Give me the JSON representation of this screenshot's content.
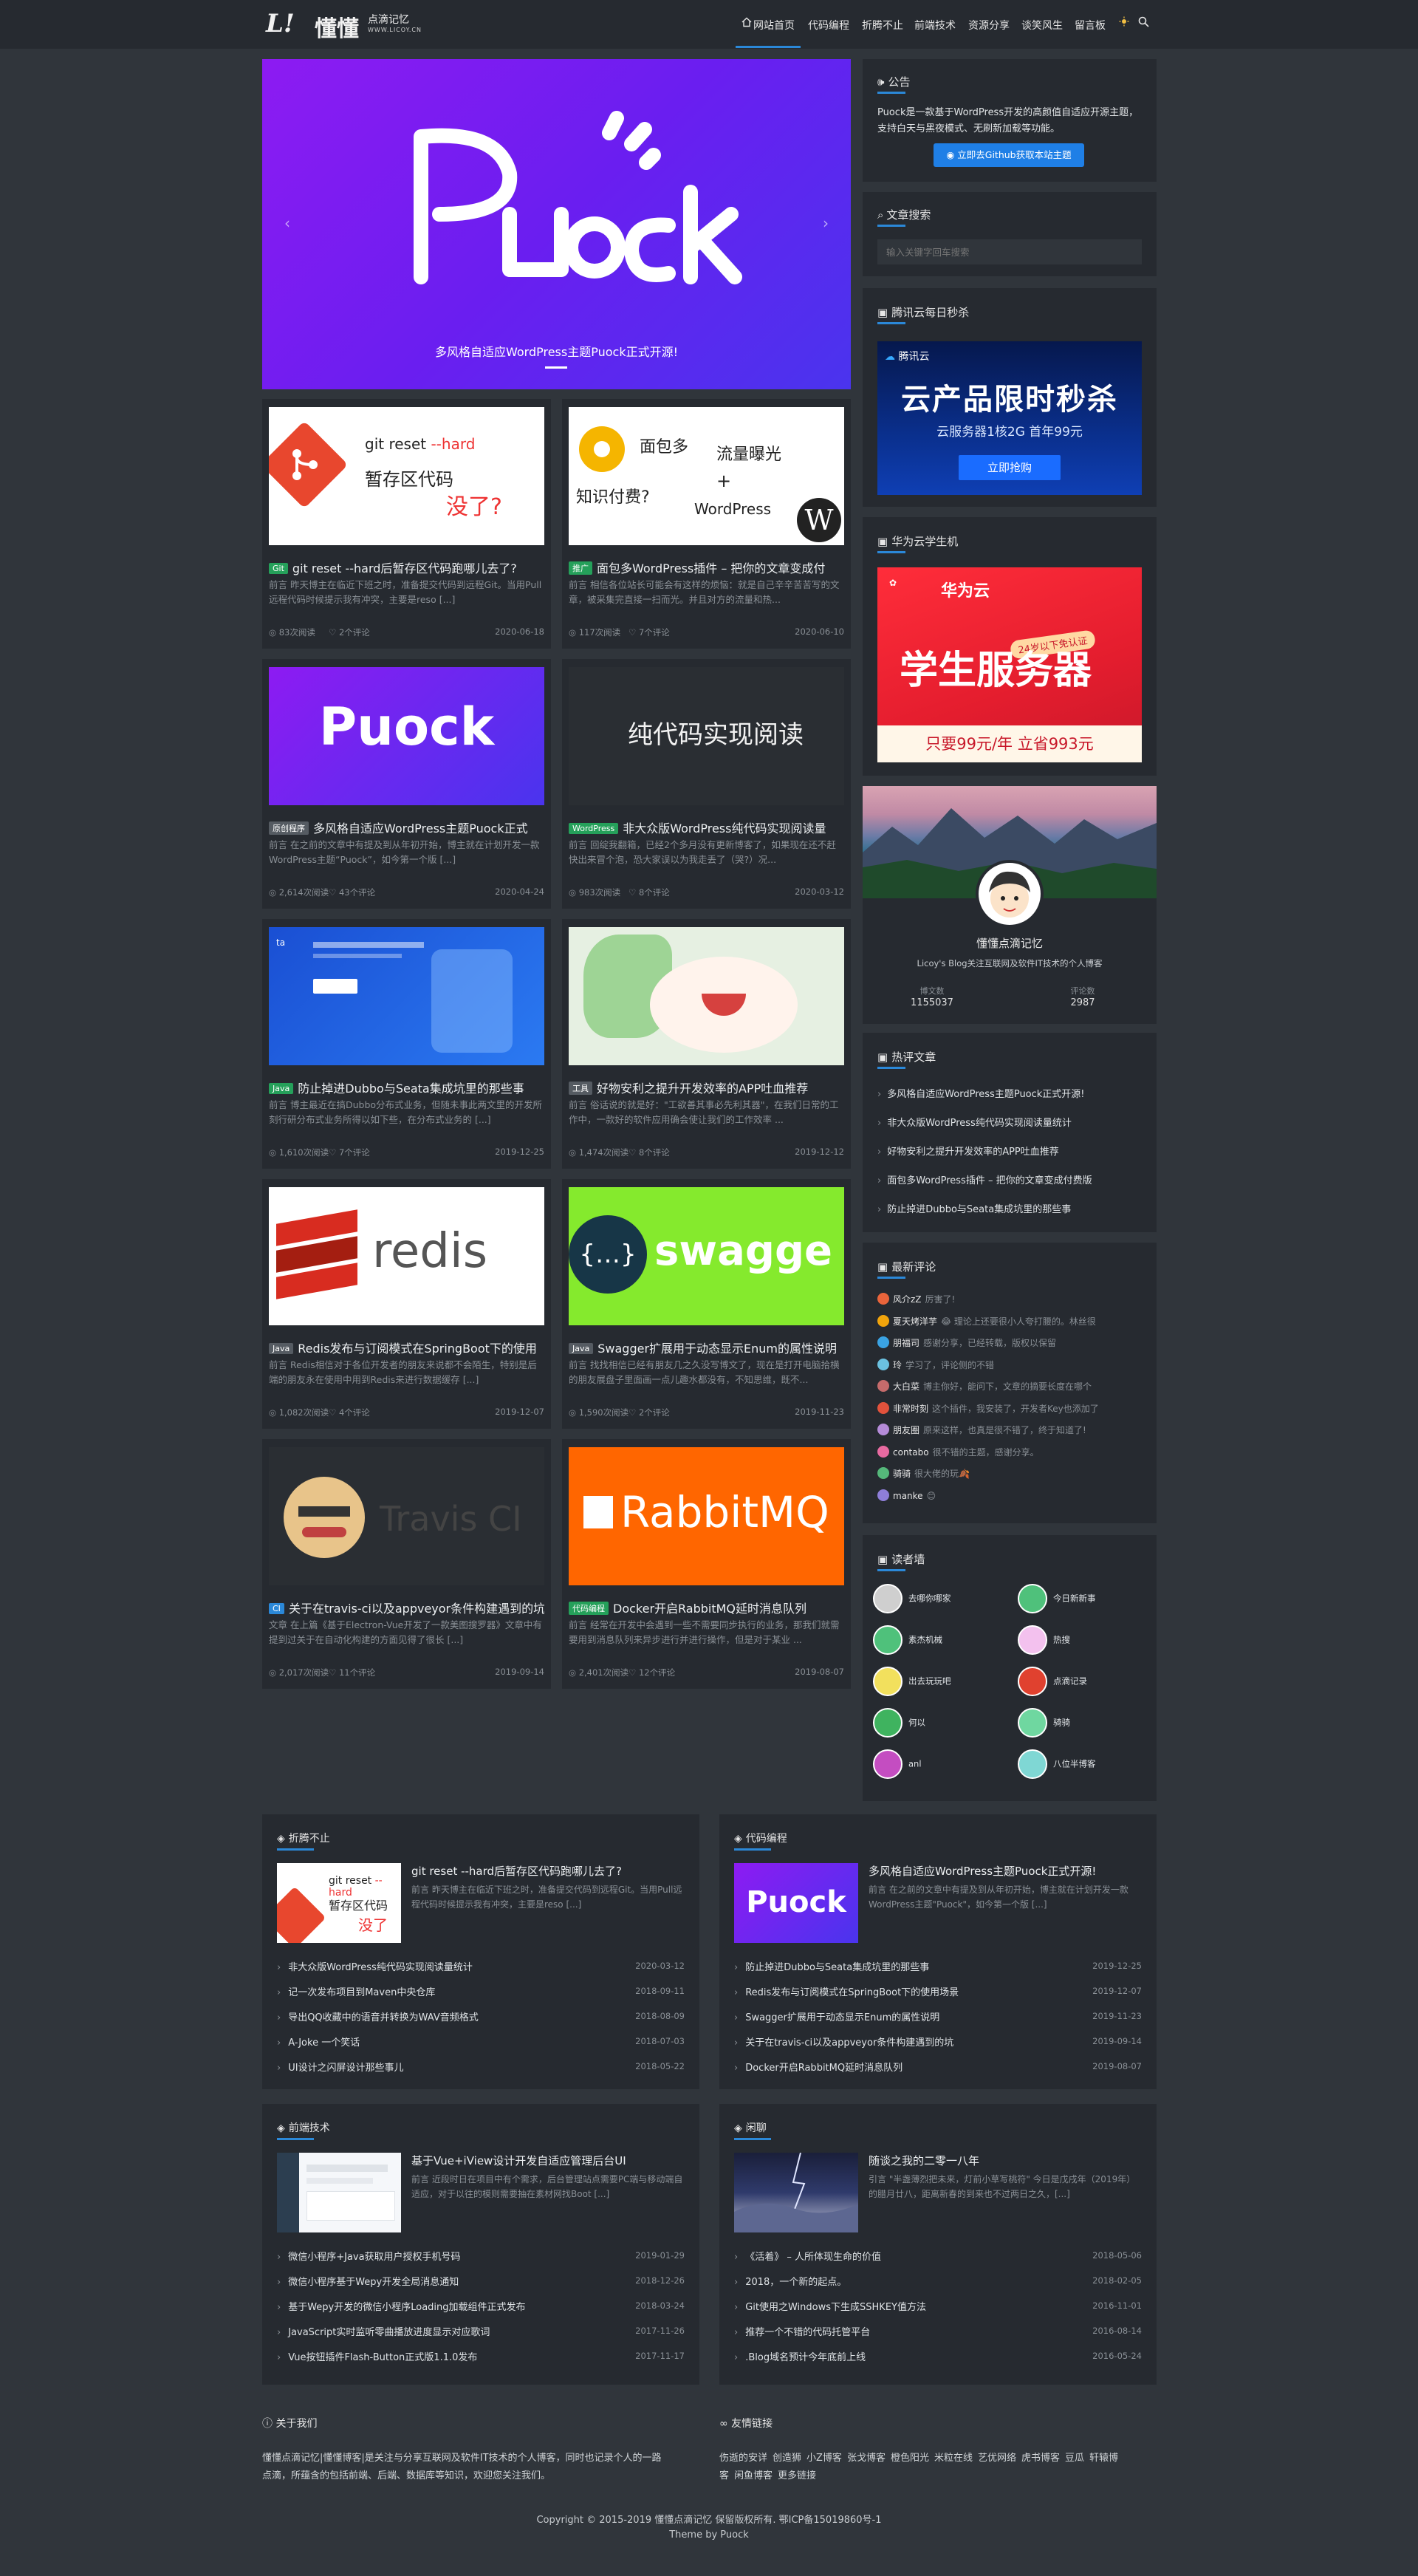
{
  "nav": {
    "logo_letters": "L!",
    "logo_title": "懂懂",
    "logo_script": "点滴记忆",
    "logo_url": "WWW.LICOY.CN",
    "items": [
      "网站首页",
      "代码编程",
      "折腾不止",
      "前端技术",
      "资源分享",
      "谈笑风生",
      "留言板"
    ],
    "theme_icon": "sun-icon",
    "search_icon": "search-icon"
  },
  "colors": {
    "accent": "#2b88d8",
    "bg": "#30353b",
    "card": "#262a30"
  },
  "slider": {
    "caption": "多风格自适应WordPress主题Puock正式开源!",
    "logo_text": "Puock"
  },
  "posts": [
    {
      "tag": "Git",
      "tag_color": "#25a05a",
      "title": "git reset --hard后暂存区代码跑哪儿去了?",
      "excerpt": "前言 昨天博主在临近下班之时，准备提交代码到远程Git。当用Pull远程代码时候提示我有冲突，主要是reso [...]",
      "views": "83次阅读",
      "comments": "2个评论",
      "date": "2020-06-18"
    },
    {
      "tag": "推广",
      "tag_color": "#25a05a",
      "title": "面包多WordPress插件 – 把你的文章变成付",
      "excerpt": "前言 相信各位站长可能会有这样的烦恼：就是自己辛辛苦苦写的文章，被采集完直接一扫而光。并且对方的流量和热...",
      "views": "117次阅读",
      "comments": "7个评论",
      "date": "2020-06-10"
    },
    {
      "tag": "原创程序",
      "tag_color": "#555b62",
      "title": "多风格自适应WordPress主题Puock正式",
      "excerpt": "前言 在之前的文章中有提及到从年初开始，博主就在计划开发一款WordPress主题“Puock”，如今第一个版 [...]",
      "views": "2,614次阅读",
      "comments": "43个评论",
      "date": "2020-04-24"
    },
    {
      "tag": "WordPress",
      "tag_color": "#25a05a",
      "title": "非大众版WordPress纯代码实现阅读量",
      "excerpt": "前言 回绽我翻箱，已经2个多月没有更新博客了，如果现在还不赶快出来冒个泡，恐大家误以为我走丢了（哭?）况...",
      "views": "983次阅读",
      "comments": "8个评论",
      "date": "2020-03-12"
    },
    {
      "tag": "Java",
      "tag_color": "#25a05a",
      "title": "防止掉进Dubbo与Seata集成坑里的那些事",
      "excerpt": "前言 博主最近在搞Dubbo分布式业务，但随未事此两文里的开发所刻行研分布式业务所得以如下些，在分布式业务的 [...]",
      "views": "1,610次阅读",
      "comments": "7个评论",
      "date": "2019-12-25"
    },
    {
      "tag": "工具",
      "tag_color": "#555b62",
      "title": "好物安利之提升开发效率的APP吐血推荐",
      "excerpt": "前言 俗话说的就是好：\"工欲善其事必先利其器\"，在我们日常的工作中，一款好的软件应用确会使让我们的工作效率 ...",
      "views": "1,474次阅读",
      "comments": "8个评论",
      "date": "2019-12-12"
    },
    {
      "tag": "Java",
      "tag_color": "#555b62",
      "title": "Redis发布与订阅模式在SpringBoot下的使用",
      "excerpt": "前言 Redis相信对于各位开发者的朋友来说都不会陌生，特别是后端的朋友永在使用中用到Redis来进行数据缓存 [...]",
      "views": "1,082次阅读",
      "comments": "4个评论",
      "date": "2019-12-07"
    },
    {
      "tag": "Java",
      "tag_color": "#555b62",
      "title": "Swagger扩展用于动态显示Enum的属性说明",
      "excerpt": "前言 找找相信已经有朋友几之久没写博文了，现在是打开电脑拾横的朋友展盘子里面画一点儿趣水都没有，不知思维，既不... ",
      "views": "1,590次阅读",
      "comments": "2个评论",
      "date": "2019-11-23"
    },
    {
      "tag": "CI",
      "tag_color": "#2b88d8",
      "title": "关于在travis-ci以及appveyor条件构建遇到的坑",
      "excerpt": "文章 在上篇《基于Electron-Vue开发了一款美图搜罗器》文章中有提到过关于在自动化构建的方面见得了很长 [...]",
      "views": "2,017次阅读",
      "comments": "11个评论",
      "date": "2019-09-14"
    },
    {
      "tag": "代码编程",
      "tag_color": "#25a05a",
      "title": "Docker开启RabbitMQ延时消息队列",
      "excerpt": "前言 经常在开发中会遇到一些不需要同步执行的业务，那我们就需要用到消息队列来异步进行并进行操作，但是对于某业 ...",
      "views": "2,401次阅读",
      "comments": "12个评论",
      "date": "2019-08-07"
    }
  ],
  "sidebar": {
    "notice": {
      "title": "公告",
      "text": "Puock是一款基于WordPress开发的高颜值自适应开源主题，支持白天与黑夜模式、无刷新加载等功能。",
      "button": "立即去Github获取本站主题"
    },
    "search": {
      "title": "文章搜索",
      "placeholder": "输入关键字回车搜索"
    },
    "ad1": {
      "title": "腾讯云每日秒杀",
      "brand": "腾讯云",
      "headline": "云产品限时秒杀",
      "sub": "云服务器1核2G  首年99元",
      "button": "立即抢购"
    },
    "ad2": {
      "title": "华为云学生机",
      "brand": "华为云",
      "headline": "学生服务器",
      "badge": "24岁以下免认证",
      "price": "只要99元/年 立省993元"
    },
    "profile": {
      "name": "懂懂点滴记忆",
      "desc": "Licoy's Blog关注互联网及软件IT技术的个人博客",
      "stats": [
        {
          "label": "博文数",
          "value": "1155037"
        },
        {
          "label": "评论数",
          "value": "2987"
        }
      ]
    },
    "hot": {
      "title": "热评文章",
      "items": [
        "多风格自适应WordPress主题Puock正式开源!",
        "非大众版WordPress纯代码实现阅读量统计",
        "好物安利之提升开发效率的APP吐血推荐",
        "面包多WordPress插件 – 把你的文章变成付费版",
        "防止掉进Dubbo与Seata集成坑里的那些事"
      ]
    },
    "comments": {
      "title": "最新评论",
      "items": [
        {
          "user": "风介zZ",
          "text": "厉害了!"
        },
        {
          "user": "夏天烤洋芋",
          "text": "😂 理论上还要很小人夸打腰的。林丝很"
        },
        {
          "user": "朋福司",
          "text": "感谢分享，已经转载，版权以保留"
        },
        {
          "user": "玲",
          "text": "学习了，评论侧的不错"
        },
        {
          "user": "大白菜",
          "text": "博主你好，能问下，文章的摘要长度在哪个"
        },
        {
          "user": "非常时刻",
          "text": "这个插件，我安装了，开发者Key也添加了"
        },
        {
          "user": "朋友圈",
          "text": "原来这样，也真是很不错了，终于知道了!"
        },
        {
          "user": "contabo",
          "text": "很不错的主题，感谢分享。"
        },
        {
          "user": "骑骑",
          "text": "很大佬的玩🍂"
        },
        {
          "user": "manke",
          "text": "😊"
        }
      ]
    },
    "readers": {
      "title": "读者墙",
      "items": [
        "去哪你哪家",
        "今日新新事",
        "素杰机械",
        "热搜",
        "岀去玩玩吧",
        "点滴记录",
        "何以",
        "骑骑",
        "anl",
        "八位半博客"
      ]
    }
  },
  "sections": [
    {
      "title": "折腾不止",
      "feature_title": "git reset --hard后暂存区代码跑哪儿去了?",
      "feature_excerpt": "前言 昨天博主在临近下班之时，准备提交代码到远程Git。当用Pull远程代码时候提示我有冲突，主要是reso [...]",
      "items": [
        {
          "t": "非大众版WordPress纯代码实现阅读量统计",
          "d": "2020-03-12"
        },
        {
          "t": "记一次发布项目到Maven中央仓库",
          "d": "2018-09-11"
        },
        {
          "t": "导出QQ收藏中的语音并转换为WAV音频格式",
          "d": "2018-08-09"
        },
        {
          "t": "A-Joke 一个笑话",
          "d": "2018-07-03"
        },
        {
          "t": "UI设计之闪屏设计那些事儿",
          "d": "2018-05-22"
        }
      ]
    },
    {
      "title": "代码编程",
      "feature_title": "多风格自适应WordPress主题Puock正式开源!",
      "feature_excerpt": "前言 在之前的文章中有提及到从年初开始，博主就在计划开发一款WordPress主题\"Puock\"，如今第一个版 [...]",
      "items": [
        {
          "t": "防止掉进Dubbo与Seata集成坑里的那些事",
          "d": "2019-12-25"
        },
        {
          "t": "Redis发布与订阅模式在SpringBoot下的使用场景",
          "d": "2019-12-07"
        },
        {
          "t": "Swagger扩展用于动态显示Enum的属性说明",
          "d": "2019-11-23"
        },
        {
          "t": "关于在travis-ci以及appveyor条件构建遇到的坑",
          "d": "2019-09-14"
        },
        {
          "t": "Docker开启RabbitMQ延时消息队列",
          "d": "2019-08-07"
        }
      ]
    },
    {
      "title": "前端技术",
      "feature_title": "基于Vue+iView设计开发自适应管理后台UI",
      "feature_excerpt": "前言 近段时日在项目中有个需求，后台管理站点需要PC端与移动端自适应，对于以往的模则需要抽在素材网找Boot [...]",
      "items": [
        {
          "t": "微信小程序+Java获取用户授权手机号码",
          "d": "2019-01-29"
        },
        {
          "t": "微信小程序基于Wepy开发全局消息通知",
          "d": "2018-12-26"
        },
        {
          "t": "基于Wepy开发的微信小程序Loading加载组件正式发布",
          "d": "2018-03-24"
        },
        {
          "t": "JavaScript实时监听零曲播放进度显示对应歌词",
          "d": "2017-11-26"
        },
        {
          "t": "Vue按钮插件Flash-Button正式版1.1.0发布",
          "d": "2017-11-17"
        }
      ]
    },
    {
      "title": "闲聊",
      "feature_title": "随谈之我的二零一八年",
      "feature_excerpt": "引言 \"半盏薄烈把未来，灯前小草写桃符\" 今日是戊戌年（2019年）的腊月廿八，距离新春的到来也不过两日之久，[...]",
      "items": [
        {
          "t": "《活着》 – 人所体现生命的价值",
          "d": "2018-05-06"
        },
        {
          "t": "2018，一个新的起点。",
          "d": "2018-02-05"
        },
        {
          "t": "Git使用之Windows下生成SSHKEY值方法",
          "d": "2016-11-01"
        },
        {
          "t": "推荐一个不错的代码托管平台",
          "d": "2016-08-14"
        },
        {
          "t": ".Blog域名预计今年底前上线",
          "d": "2016-05-24"
        }
      ]
    }
  ],
  "footer": {
    "about_title": "关于我们",
    "about_text": "懂懂点滴记忆|懂懂博客|是关注与分享互联网及软件IT技术的个人博客，同时也记录个人的一路点滴，所蕴含的包括前端、后端、数据库等知识，欢迎您关注我们。",
    "links_title": "友情链接",
    "links": [
      "伤逝的安详",
      "创造狮",
      "小Z博客",
      "张戈博客",
      "橙色阳光",
      "米粒在线",
      "艺优网络",
      "虎书博客",
      "豆瓜",
      "轩辕博客",
      "闲鱼博客",
      "更多链接"
    ],
    "copyright": "Copyright © 2015-2019 懂懂点滴记忆 保留版权所有. 鄂ICP备15019860号-1",
    "theme": "Theme by Puock"
  }
}
